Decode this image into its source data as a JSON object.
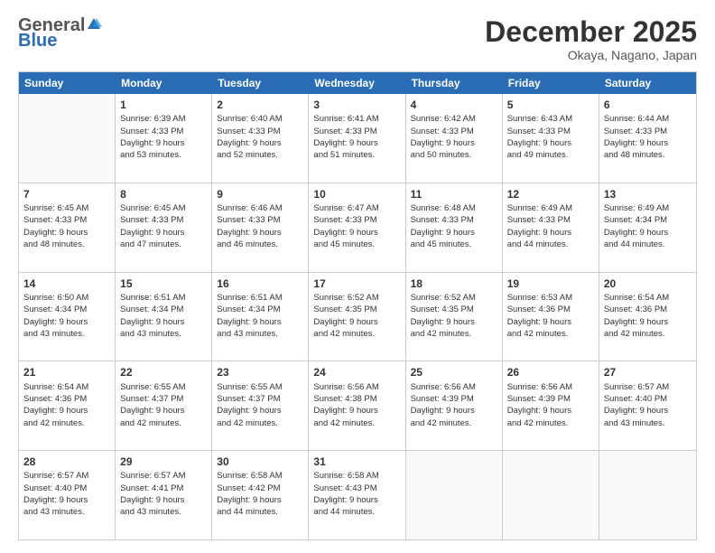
{
  "header": {
    "logo_general": "General",
    "logo_blue": "Blue",
    "month_title": "December 2025",
    "location": "Okaya, Nagano, Japan"
  },
  "calendar": {
    "days_of_week": [
      "Sunday",
      "Monday",
      "Tuesday",
      "Wednesday",
      "Thursday",
      "Friday",
      "Saturday"
    ],
    "weeks": [
      [
        {
          "day": "",
          "info": ""
        },
        {
          "day": "1",
          "info": "Sunrise: 6:39 AM\nSunset: 4:33 PM\nDaylight: 9 hours\nand 53 minutes."
        },
        {
          "day": "2",
          "info": "Sunrise: 6:40 AM\nSunset: 4:33 PM\nDaylight: 9 hours\nand 52 minutes."
        },
        {
          "day": "3",
          "info": "Sunrise: 6:41 AM\nSunset: 4:33 PM\nDaylight: 9 hours\nand 51 minutes."
        },
        {
          "day": "4",
          "info": "Sunrise: 6:42 AM\nSunset: 4:33 PM\nDaylight: 9 hours\nand 50 minutes."
        },
        {
          "day": "5",
          "info": "Sunrise: 6:43 AM\nSunset: 4:33 PM\nDaylight: 9 hours\nand 49 minutes."
        },
        {
          "day": "6",
          "info": "Sunrise: 6:44 AM\nSunset: 4:33 PM\nDaylight: 9 hours\nand 48 minutes."
        }
      ],
      [
        {
          "day": "7",
          "info": "Sunrise: 6:45 AM\nSunset: 4:33 PM\nDaylight: 9 hours\nand 48 minutes."
        },
        {
          "day": "8",
          "info": "Sunrise: 6:45 AM\nSunset: 4:33 PM\nDaylight: 9 hours\nand 47 minutes."
        },
        {
          "day": "9",
          "info": "Sunrise: 6:46 AM\nSunset: 4:33 PM\nDaylight: 9 hours\nand 46 minutes."
        },
        {
          "day": "10",
          "info": "Sunrise: 6:47 AM\nSunset: 4:33 PM\nDaylight: 9 hours\nand 45 minutes."
        },
        {
          "day": "11",
          "info": "Sunrise: 6:48 AM\nSunset: 4:33 PM\nDaylight: 9 hours\nand 45 minutes."
        },
        {
          "day": "12",
          "info": "Sunrise: 6:49 AM\nSunset: 4:33 PM\nDaylight: 9 hours\nand 44 minutes."
        },
        {
          "day": "13",
          "info": "Sunrise: 6:49 AM\nSunset: 4:34 PM\nDaylight: 9 hours\nand 44 minutes."
        }
      ],
      [
        {
          "day": "14",
          "info": "Sunrise: 6:50 AM\nSunset: 4:34 PM\nDaylight: 9 hours\nand 43 minutes."
        },
        {
          "day": "15",
          "info": "Sunrise: 6:51 AM\nSunset: 4:34 PM\nDaylight: 9 hours\nand 43 minutes."
        },
        {
          "day": "16",
          "info": "Sunrise: 6:51 AM\nSunset: 4:34 PM\nDaylight: 9 hours\nand 43 minutes."
        },
        {
          "day": "17",
          "info": "Sunrise: 6:52 AM\nSunset: 4:35 PM\nDaylight: 9 hours\nand 42 minutes."
        },
        {
          "day": "18",
          "info": "Sunrise: 6:52 AM\nSunset: 4:35 PM\nDaylight: 9 hours\nand 42 minutes."
        },
        {
          "day": "19",
          "info": "Sunrise: 6:53 AM\nSunset: 4:36 PM\nDaylight: 9 hours\nand 42 minutes."
        },
        {
          "day": "20",
          "info": "Sunrise: 6:54 AM\nSunset: 4:36 PM\nDaylight: 9 hours\nand 42 minutes."
        }
      ],
      [
        {
          "day": "21",
          "info": "Sunrise: 6:54 AM\nSunset: 4:36 PM\nDaylight: 9 hours\nand 42 minutes."
        },
        {
          "day": "22",
          "info": "Sunrise: 6:55 AM\nSunset: 4:37 PM\nDaylight: 9 hours\nand 42 minutes."
        },
        {
          "day": "23",
          "info": "Sunrise: 6:55 AM\nSunset: 4:37 PM\nDaylight: 9 hours\nand 42 minutes."
        },
        {
          "day": "24",
          "info": "Sunrise: 6:56 AM\nSunset: 4:38 PM\nDaylight: 9 hours\nand 42 minutes."
        },
        {
          "day": "25",
          "info": "Sunrise: 6:56 AM\nSunset: 4:39 PM\nDaylight: 9 hours\nand 42 minutes."
        },
        {
          "day": "26",
          "info": "Sunrise: 6:56 AM\nSunset: 4:39 PM\nDaylight: 9 hours\nand 42 minutes."
        },
        {
          "day": "27",
          "info": "Sunrise: 6:57 AM\nSunset: 4:40 PM\nDaylight: 9 hours\nand 43 minutes."
        }
      ],
      [
        {
          "day": "28",
          "info": "Sunrise: 6:57 AM\nSunset: 4:40 PM\nDaylight: 9 hours\nand 43 minutes."
        },
        {
          "day": "29",
          "info": "Sunrise: 6:57 AM\nSunset: 4:41 PM\nDaylight: 9 hours\nand 43 minutes."
        },
        {
          "day": "30",
          "info": "Sunrise: 6:58 AM\nSunset: 4:42 PM\nDaylight: 9 hours\nand 44 minutes."
        },
        {
          "day": "31",
          "info": "Sunrise: 6:58 AM\nSunset: 4:43 PM\nDaylight: 9 hours\nand 44 minutes."
        },
        {
          "day": "",
          "info": ""
        },
        {
          "day": "",
          "info": ""
        },
        {
          "day": "",
          "info": ""
        }
      ]
    ]
  }
}
